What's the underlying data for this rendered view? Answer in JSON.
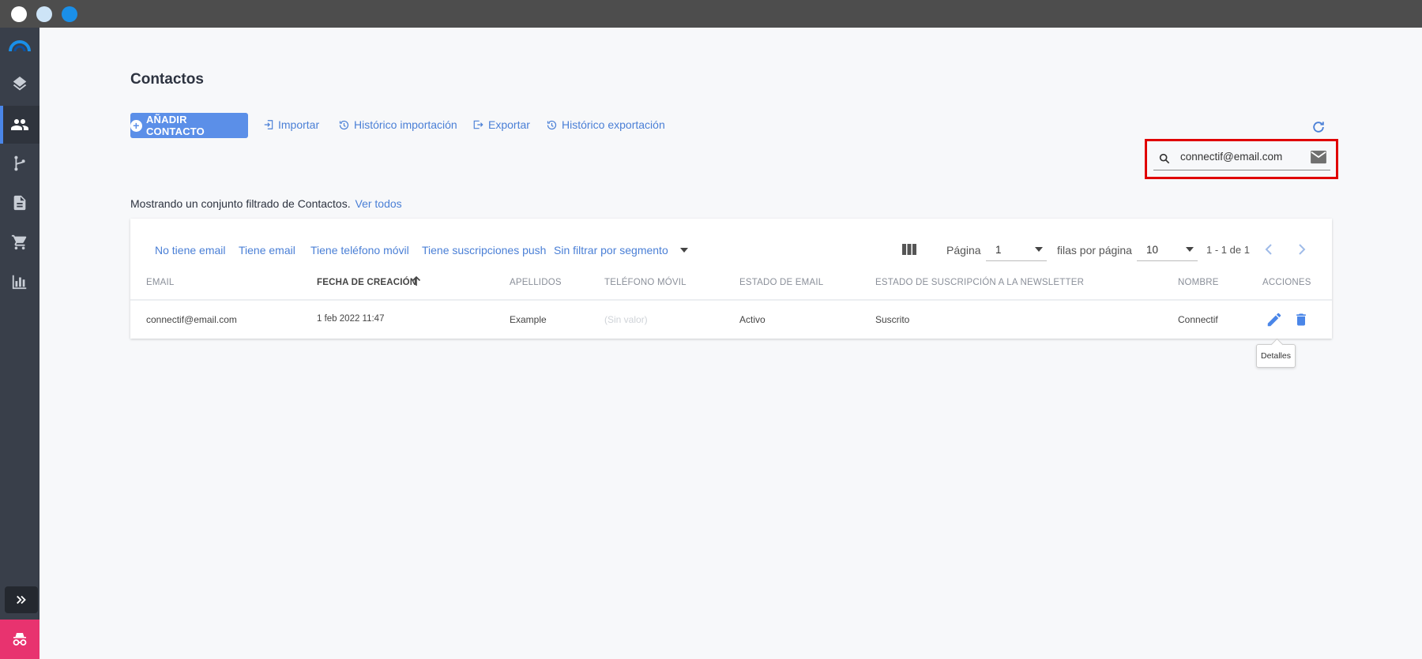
{
  "window": {
    "traffic_lights": [
      "#ffffff",
      "#cde4f7",
      "#1a8fe8"
    ]
  },
  "sidebar": {
    "items": [
      {
        "icon": "logo-icon"
      },
      {
        "icon": "layers-icon"
      },
      {
        "icon": "contacts-icon",
        "active": true
      },
      {
        "icon": "workflow-icon"
      },
      {
        "icon": "document-icon"
      },
      {
        "icon": "cart-icon"
      },
      {
        "icon": "analytics-icon"
      }
    ],
    "expand_icon": "double-chevron-right-icon",
    "incognito_icon": "incognito-icon"
  },
  "page": {
    "title": "Contactos"
  },
  "toolbar": {
    "add_label": "AÑADIR CONTACTO",
    "import_label": "Importar",
    "import_history_label": "Histórico importación",
    "export_label": "Exportar",
    "export_history_label": "Histórico exportación",
    "accent": "#5b8fe8"
  },
  "search": {
    "value": "connectif@email.com"
  },
  "filter_note": {
    "text": "Mostrando un conjunto filtrado de Contactos.",
    "link": "Ver todos"
  },
  "filters": {
    "no_email": "No tiene email",
    "has_email": "Tiene email",
    "has_mobile": "Tiene teléfono móvil",
    "has_push": "Tiene suscripciones push",
    "segment": "Sin filtrar por segmento"
  },
  "pagination": {
    "page_label": "Página",
    "page_value": "1",
    "rows_label": "filas por página",
    "rows_value": "10",
    "range": "1 - 1 de 1"
  },
  "table": {
    "headers": {
      "email": "EMAIL",
      "created": "FECHA DE CREACIÓN",
      "surname": "APELLIDOS",
      "mobile": "TELÉFONO MÓVIL",
      "email_status": "ESTADO DE EMAIL",
      "newsletter_status": "ESTADO DE SUSCRIPCIÓN A LA NEWSLETTER",
      "name": "NOMBRE",
      "actions": "ACCIONES"
    },
    "rows": [
      {
        "email": "connectif@email.com",
        "created": "1 feb 2022 11:47",
        "surname": "Example",
        "mobile": "(Sin valor)",
        "email_status": "Activo",
        "newsletter_status": "Suscrito",
        "name": "Connectif"
      }
    ]
  },
  "tooltip": {
    "text": "Detalles"
  }
}
